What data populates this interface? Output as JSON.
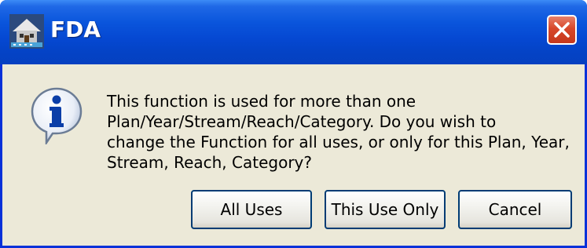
{
  "window": {
    "title": "FDA",
    "app_icon": "fda-app-icon",
    "close_icon": "close-icon"
  },
  "dialog": {
    "icon": "info-icon",
    "message_lines": [
      "This function is used for more than one",
      "Plan/Year/Stream/Reach/Category.  Do you wish to",
      "change the Function for all uses, or only for this Plan, Year,",
      "Stream, Reach, Category?"
    ]
  },
  "buttons": {
    "all_uses": "All Uses",
    "this_use_only": "This Use Only",
    "cancel": "Cancel"
  },
  "colors": {
    "titlebar": "#0A55DC",
    "dialog_bg": "#ECE9D8",
    "close_button": "#D7472A",
    "button_border": "#003C74"
  }
}
